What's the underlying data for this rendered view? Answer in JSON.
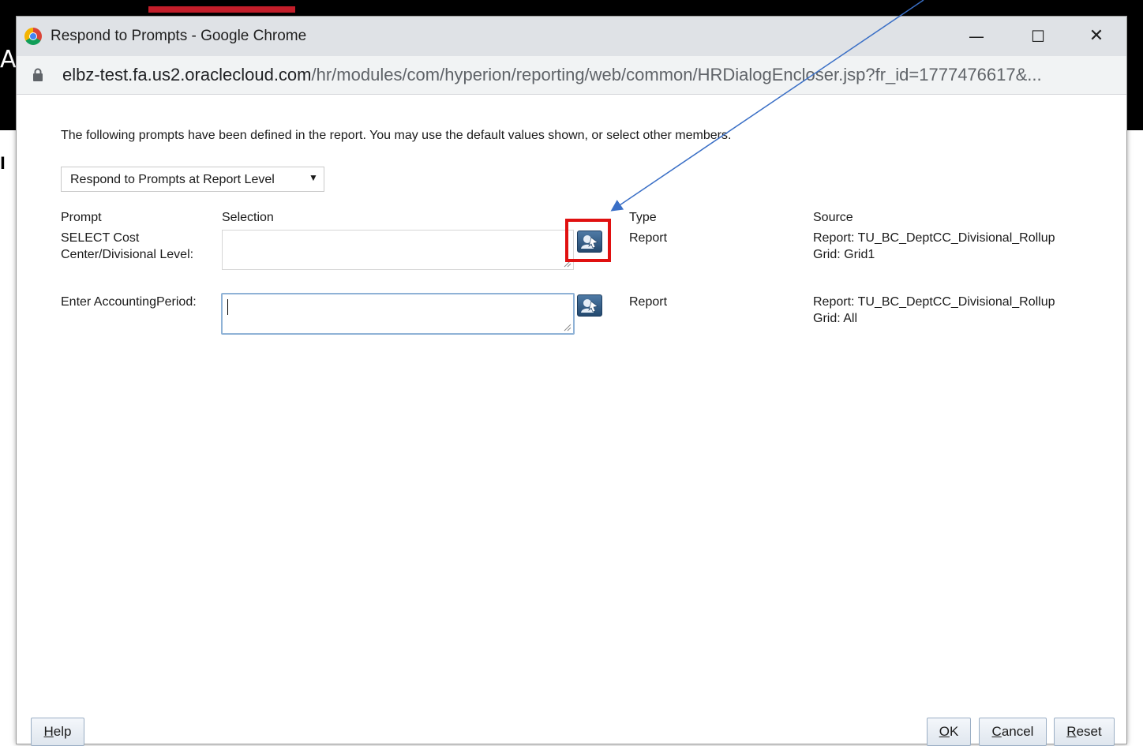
{
  "background_app": {
    "letter_top": "A",
    "letter_side": "l"
  },
  "window": {
    "title": "Respond to Prompts - Google Chrome",
    "minimize_glyph": "—",
    "maximize_glyph": "☐",
    "close_glyph": "✕"
  },
  "urlbar": {
    "host": "elbz-test.fa.us2.oraclecloud.com",
    "path": "/hr/modules/com/hyperion/reporting/web/common/HRDialogEncloser.jsp?fr_id=1777476617&..."
  },
  "dialog": {
    "intro": "The following prompts have been defined in the report. You may use the default values shown, or select other members.",
    "level_select": {
      "value": "Respond to Prompts at Report Level",
      "arrow": "▼"
    },
    "columns": {
      "prompt": "Prompt",
      "selection": "Selection",
      "type": "Type",
      "source": "Source"
    },
    "prompts": [
      {
        "prompt_line1": "SELECT Cost",
        "prompt_line2": "Center/Divisional Level:",
        "selection_value": "",
        "type": "Report",
        "source_report": "Report: TU_BC_DeptCC_Divisional_Rollup",
        "source_grid": "Grid: Grid1"
      },
      {
        "prompt_line1": "Enter AccountingPeriod:",
        "selection_value": "",
        "type": "Report",
        "source_report": "Report: TU_BC_DeptCC_Divisional_Rollup",
        "source_grid": "Grid: All"
      }
    ]
  },
  "footer": {
    "help": {
      "underline": "H",
      "rest": "elp"
    },
    "ok": {
      "underline": "O",
      "rest": "K"
    },
    "cancel": {
      "underline": "C",
      "rest": "ancel"
    },
    "reset": {
      "underline": "R",
      "rest": "eset"
    }
  },
  "colors": {
    "annotation_red": "#e01010",
    "annotation_arrow": "#3a6fc6",
    "focus_border": "#8fb2d6",
    "titlebar": "#dfe2e6"
  },
  "icons": [
    "chrome-icon",
    "lock-icon",
    "member-select-icon",
    "resize-grip-icon"
  ]
}
